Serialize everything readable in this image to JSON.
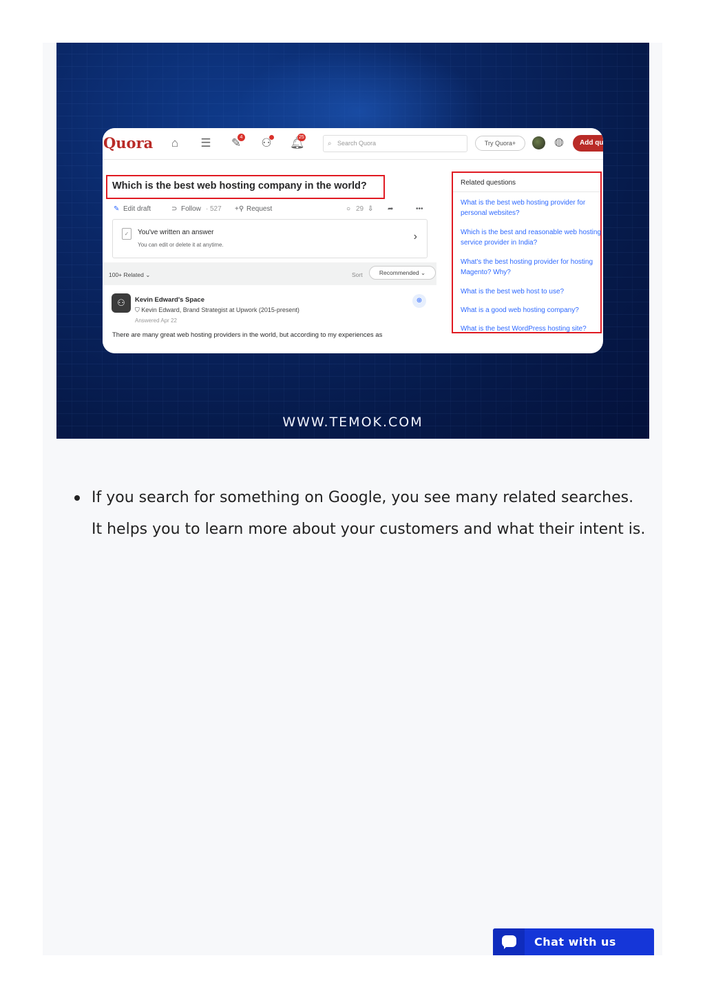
{
  "hero": {
    "footer": "WWW.TEMOK.COM",
    "quora": {
      "logo": "Quora",
      "badges": {
        "answer": "4",
        "notifications": "25"
      },
      "search_placeholder": "Search Quora",
      "try_label": "Try Quora+",
      "add_label": "Add qu",
      "question": "Which is the best web hosting company in the world?",
      "actions": {
        "edit": "Edit draft",
        "follow": "Follow",
        "follow_count": "527",
        "request": "Request",
        "comments": "29"
      },
      "answer_card": {
        "title": "You've written an answer",
        "subtitle": "You can edit or delete it at anytime."
      },
      "related_count": "100+ Related",
      "sort_label": "Sort",
      "sort_value": "Recommended",
      "answer": {
        "space": "Kevin Edward's Space",
        "credential": "Kevin Edward, Brand Strategist at Upwork (2015-present)",
        "date": "Answered Apr 22",
        "text": "There are many great web hosting providers in the world, but according to my experiences as"
      },
      "related": {
        "title": "Related questions",
        "items": [
          "What is the best web hosting provider for personal websites?",
          "Which is the best and reasonable web hosting service provider in India?",
          "What's the best hosting provider for hosting Magento? Why?",
          "What is the best web host to use?",
          "What is a good web hosting company?",
          "What is the best WordPress hosting site?"
        ]
      }
    }
  },
  "content": {
    "bullet": "If you search for something on Google, you see many related searches. It helps you to learn more about your customers and what their intent is."
  },
  "chat": {
    "label": "Chat with us"
  },
  "colors": {
    "chat": "#1536d8",
    "quora_red": "#b92b27",
    "highlight": "#e01a22",
    "link": "#2e69ff"
  }
}
